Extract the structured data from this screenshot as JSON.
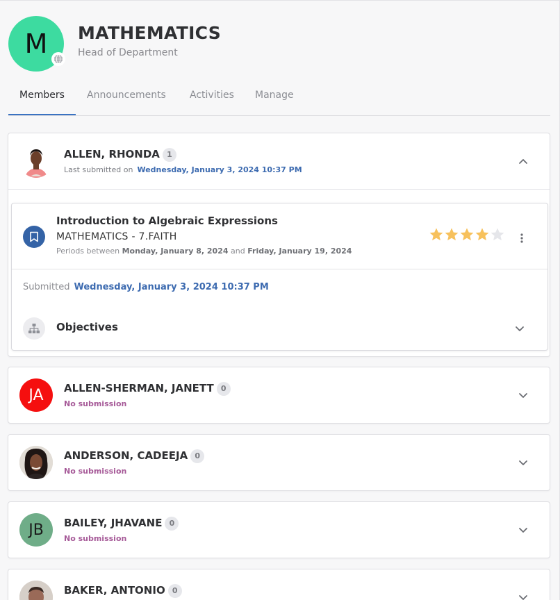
{
  "department": {
    "initial": "M",
    "title": "MATHEMATICS",
    "subtitle": "Head of Department"
  },
  "tabs": [
    {
      "label": "Members",
      "active": true
    },
    {
      "label": "Announcements",
      "active": false
    },
    {
      "label": "Activities",
      "active": false
    },
    {
      "label": "Manage",
      "active": false
    }
  ],
  "members": [
    {
      "name": "ALLEN, RHONDA",
      "count": "1",
      "status_label": "Last submitted on",
      "status_date": "Wednesday, January 3, 2024 10:37 PM",
      "avatar": "photo",
      "expanded": true
    },
    {
      "name": "ALLEN-SHERMAN, JANETT",
      "count": "0",
      "status": "No submission",
      "initials": "JA",
      "avatar_color": "#f50f0f"
    },
    {
      "name": "ANDERSON, CADEEJA",
      "count": "0",
      "status": "No submission",
      "avatar": "photo"
    },
    {
      "name": "BAILEY, JHAVANE",
      "count": "0",
      "status": "No submission",
      "initials": "JB",
      "avatar_color": "#6fad88"
    },
    {
      "name": "BAKER, ANTONIO",
      "count": "0",
      "avatar": "photo"
    }
  ],
  "activity": {
    "title": "Introduction to Algebraic Expressions",
    "class": "MATHEMATICS - 7.FAITH",
    "periods_prefix": "Periods between",
    "period_start": "Monday, January 8, 2024",
    "periods_and": "and",
    "period_end": "Friday, January 19, 2024",
    "rating": 4,
    "rating_max": 5,
    "submitted_label": "Submitted",
    "submitted_date": "Wednesday, January 3, 2024 10:37 PM",
    "objectives_label": "Objectives"
  },
  "colors": {
    "accent": "#3a73c2",
    "dept_avatar": "#3ddba0",
    "star_filled": "#f7c15c",
    "star_empty": "#e5e6ea",
    "no_submission": "#a65a98"
  }
}
